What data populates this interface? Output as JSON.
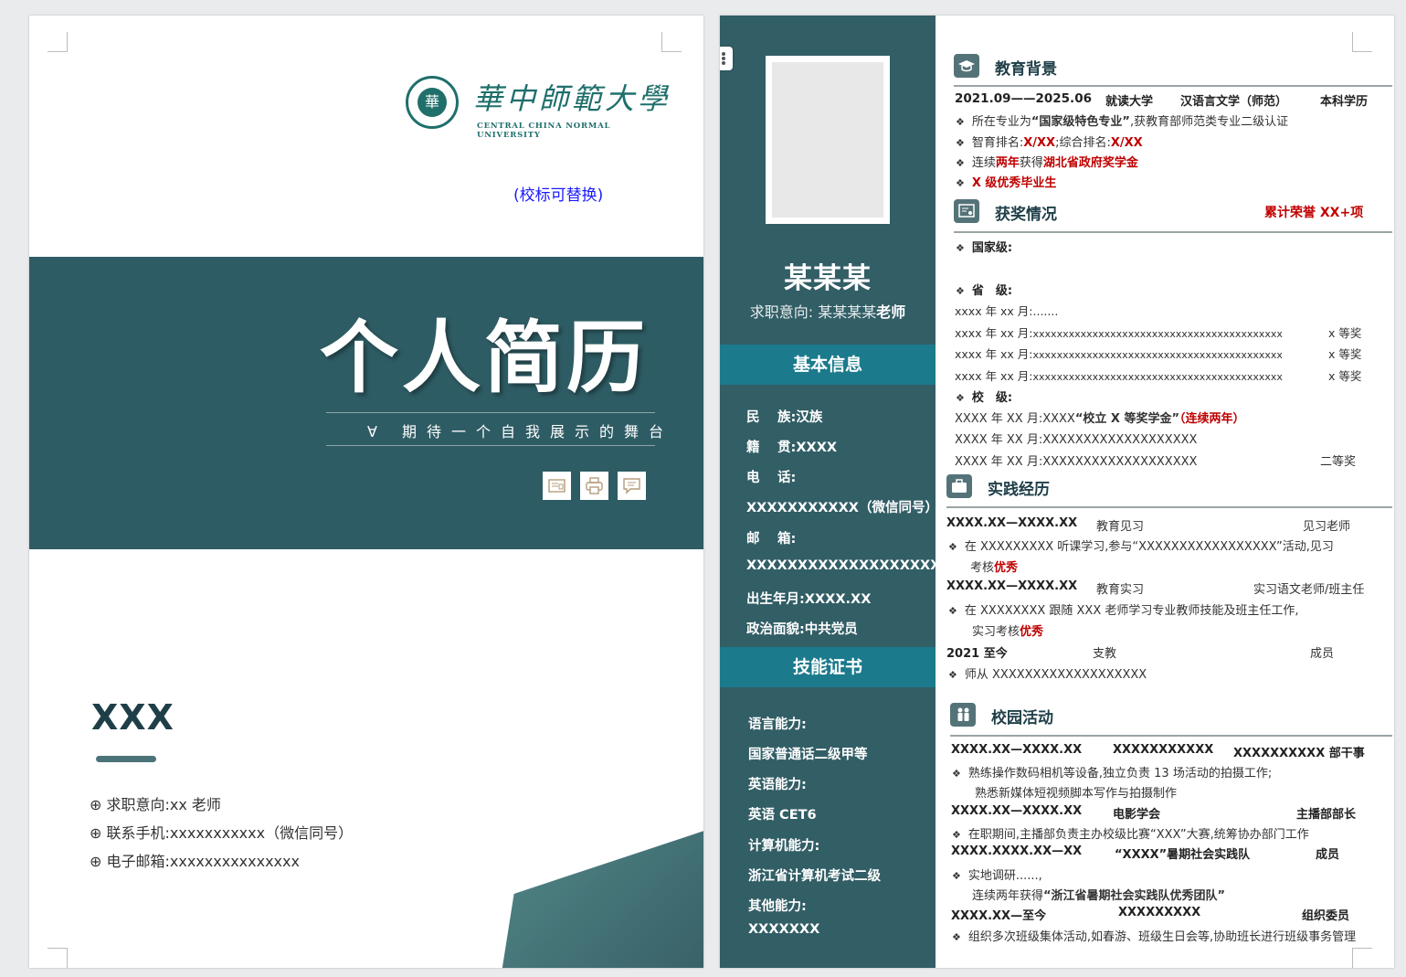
{
  "cover": {
    "logo_cn": "華中師範大學",
    "logo_en": "CENTRAL CHINA NORMAL UNIVERSITY",
    "logo_note": "(校标可替换)",
    "title": "个人简历",
    "subtitle": "∀ 期待一个自我展示的舞台",
    "name": "XXX",
    "info": [
      {
        "label": "求职意向:",
        "value": "xx 老师"
      },
      {
        "label": "联系手机:",
        "value": "xxxxxxxxxxx（微信同号）"
      },
      {
        "label": "电子邮箱:",
        "value": "xxxxxxxxxxxxxxx"
      }
    ],
    "icons": [
      "card-icon",
      "print-icon",
      "message-icon"
    ]
  },
  "side": {
    "name": "某某某",
    "objective_label": "求职意向:",
    "objective_value": "某某某某",
    "objective_role": "老师",
    "basic_title": "基本信息",
    "basic": [
      "民　 族:汉族",
      "籍　 贯:XXXX",
      "电　 话:",
      "XXXXXXXXXXX（微信同号）",
      "邮　 箱:",
      "XXXXXXXXXXXXXXXXXXXX",
      "出生年月:XXXX.XX",
      "政治面貌:中共党员"
    ],
    "skills_title": "技能证书",
    "skills": [
      "语言能力:",
      "国家普通话二级甲等",
      "英语能力:",
      "英语 CET6",
      "计算机能力:",
      "浙江省计算机考试二级",
      "其他能力:",
      "XXXXXXX"
    ]
  },
  "education": {
    "title": "教育背景",
    "period": "2021.09——2025.06",
    "school": "就读大学",
    "major": "汉语言文学（师范）",
    "degree": "本科学历",
    "b1_pre": "所在专业为",
    "b1_em": "“国家级特色专业”",
    "b1_post": ",获教育部师范类专业二级认证",
    "b2_pre": "智育排名:",
    "b2_v1": "X/XX",
    "b2_mid": ";综合排名:",
    "b2_v2": "X/XX",
    "b3_pre": "连续",
    "b3_v1": "两年",
    "b3_mid": "获得",
    "b3_v2": "湖北省政府奖学金",
    "b4": "X 级优秀毕业生"
  },
  "awards": {
    "title": "获奖情况",
    "total": "累计荣誉 XX+项",
    "national": "国家级:",
    "provincial": "省　级:",
    "p_line0": "xxxx 年 xx 月:.......",
    "p_lines": [
      {
        "date": "xxxx 年 xx 月:",
        "text": "xxxxxxxxxxxxxxxxxxxxxxxxxxxxxxxxxxxxxxxxxx",
        "prize": "x 等奖"
      },
      {
        "date": "xxxx 年 xx 月:",
        "text": "xxxxxxxxxxxxxxxxxxxxxxxxxxxxxxxxxxxxxxxxxx",
        "prize": "x 等奖"
      },
      {
        "date": "xxxx 年 xx 月:",
        "text": "xxxxxxxxxxxxxxxxxxxxxxxxxxxxxxxxxxxxxxxxxx",
        "prize": "x 等奖"
      }
    ],
    "school": "校　级:",
    "s1_pre": "XXXX 年 XX 月:XXXX",
    "s1_em": "“校立 X 等奖学金”",
    "s1_red": "（连续两年）",
    "s2": "XXXX 年 XX 月:XXXXXXXXXXXXXXXXXXX",
    "s3": "XXXX 年 XX 月:XXXXXXXXXXXXXXXXXXX",
    "s3_prize": "二等奖"
  },
  "practice": {
    "title": "实践经历",
    "e1_period": "XXXX.XX—XXXX.XX",
    "e1_name": "教育见习",
    "e1_role": "见习老师",
    "e1_l1": "在 XXXXXXXXX 听课学习,参与“XXXXXXXXXXXXXXXXX”活动,见习",
    "e1_l2_pre": "考核",
    "e1_l2_red": "优秀",
    "e2_period": "XXXX.XX—XXXX.XX",
    "e2_name": "教育实习",
    "e2_role": "实习语文老师/班主任",
    "e2_l1": "在 XXXXXXXX 跟随 XXX 老师学习专业教师技能及班主任工作,",
    "e2_l2_pre": "实习考核",
    "e2_l2_red": "优秀",
    "e3_period": "2021 至今",
    "e3_name": "支教",
    "e3_role": "成员",
    "e3_l1": "师从 XXXXXXXXXXXXXXXXXXX"
  },
  "campus": {
    "title": "校园活动",
    "c1_period": "XXXX.XX—XXXX.XX",
    "c1_org": "XXXXXXXXXXX",
    "c1_role": "XXXXXXXXXX 部干事",
    "c1_l1": "熟练操作数码相机等设备,独立负责 13 场活动的拍摄工作;",
    "c1_l2": "熟悉新媒体短视频脚本写作与拍摄制作",
    "c2_period": "XXXX.XX—XXXX.XX",
    "c2_org": "电影学会",
    "c2_role": "主播部部长",
    "c2_l1": "在职期间,主播部负责主办校级比赛“XXX”大赛,统筹协办部门工作",
    "c3_period": "XXXX.XXXX.XX—XX",
    "c3_org": "“XXXX”暑期社会实践队",
    "c3_role": "成员",
    "c3_l1": "实地调研......,",
    "c3_l2_pre": "连续两年获得",
    "c3_l2_em": "“浙江省暑期社会实践队优秀团队”",
    "c4_period": "XXXX.XX—至今",
    "c4_org": "XXXXXXXXX",
    "c4_role": "组织委员",
    "c4_l1": "组织多次班级集体活动,如春游、班级生日会等,协助班长进行班级事务管理"
  },
  "colors": {
    "primary": "#2e5c64",
    "accent": "#1b7a8c",
    "highlight": "#c00000",
    "link": "#1a1aff"
  }
}
